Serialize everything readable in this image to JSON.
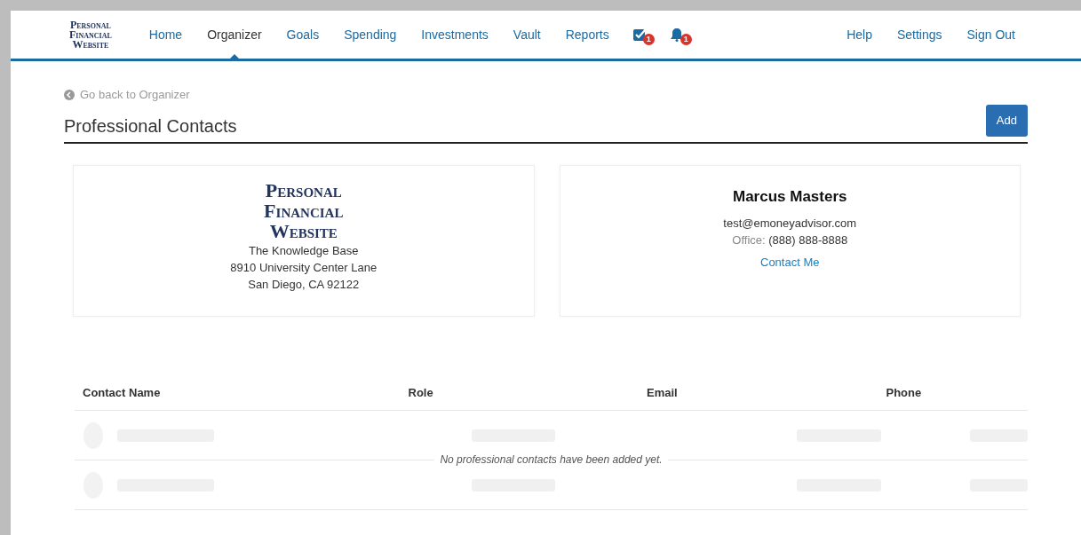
{
  "logo": {
    "lines": [
      "Personal",
      "Financial",
      "Website"
    ]
  },
  "nav": [
    {
      "label": "Home",
      "kind": "link",
      "selected": false
    },
    {
      "label": "Organizer",
      "kind": "link",
      "selected": true
    },
    {
      "label": "Goals",
      "kind": "link",
      "selected": false
    },
    {
      "label": "Spending",
      "kind": "link",
      "selected": false
    },
    {
      "label": "Investments",
      "kind": "link",
      "selected": false
    },
    {
      "label": "Vault",
      "kind": "link",
      "selected": false
    },
    {
      "label": "Reports",
      "kind": "link",
      "selected": false
    },
    {
      "kind": "tasks",
      "badge": "1"
    },
    {
      "kind": "alerts",
      "badge": "1"
    }
  ],
  "nav_right": [
    "Help",
    "Settings",
    "Sign Out"
  ],
  "back_link": "Go back to Organizer",
  "page_title": "Professional Contacts",
  "add_button": "Add",
  "firm_card": {
    "logo_lines": [
      "Personal",
      "Financial",
      "Website"
    ],
    "lines": [
      "The Knowledge Base",
      "8910 University Center Lane",
      "San Diego, CA 92122"
    ]
  },
  "advisor_card": {
    "name": "Marcus Masters",
    "email": "test@emoneyadvisor.com",
    "office_label": "Office:",
    "office_phone": "(888) 888-8888",
    "contact_link": "Contact Me"
  },
  "table": {
    "columns": [
      "Contact Name",
      "Role",
      "Email",
      "Phone"
    ],
    "empty_message": "No professional contacts have been added yet."
  }
}
